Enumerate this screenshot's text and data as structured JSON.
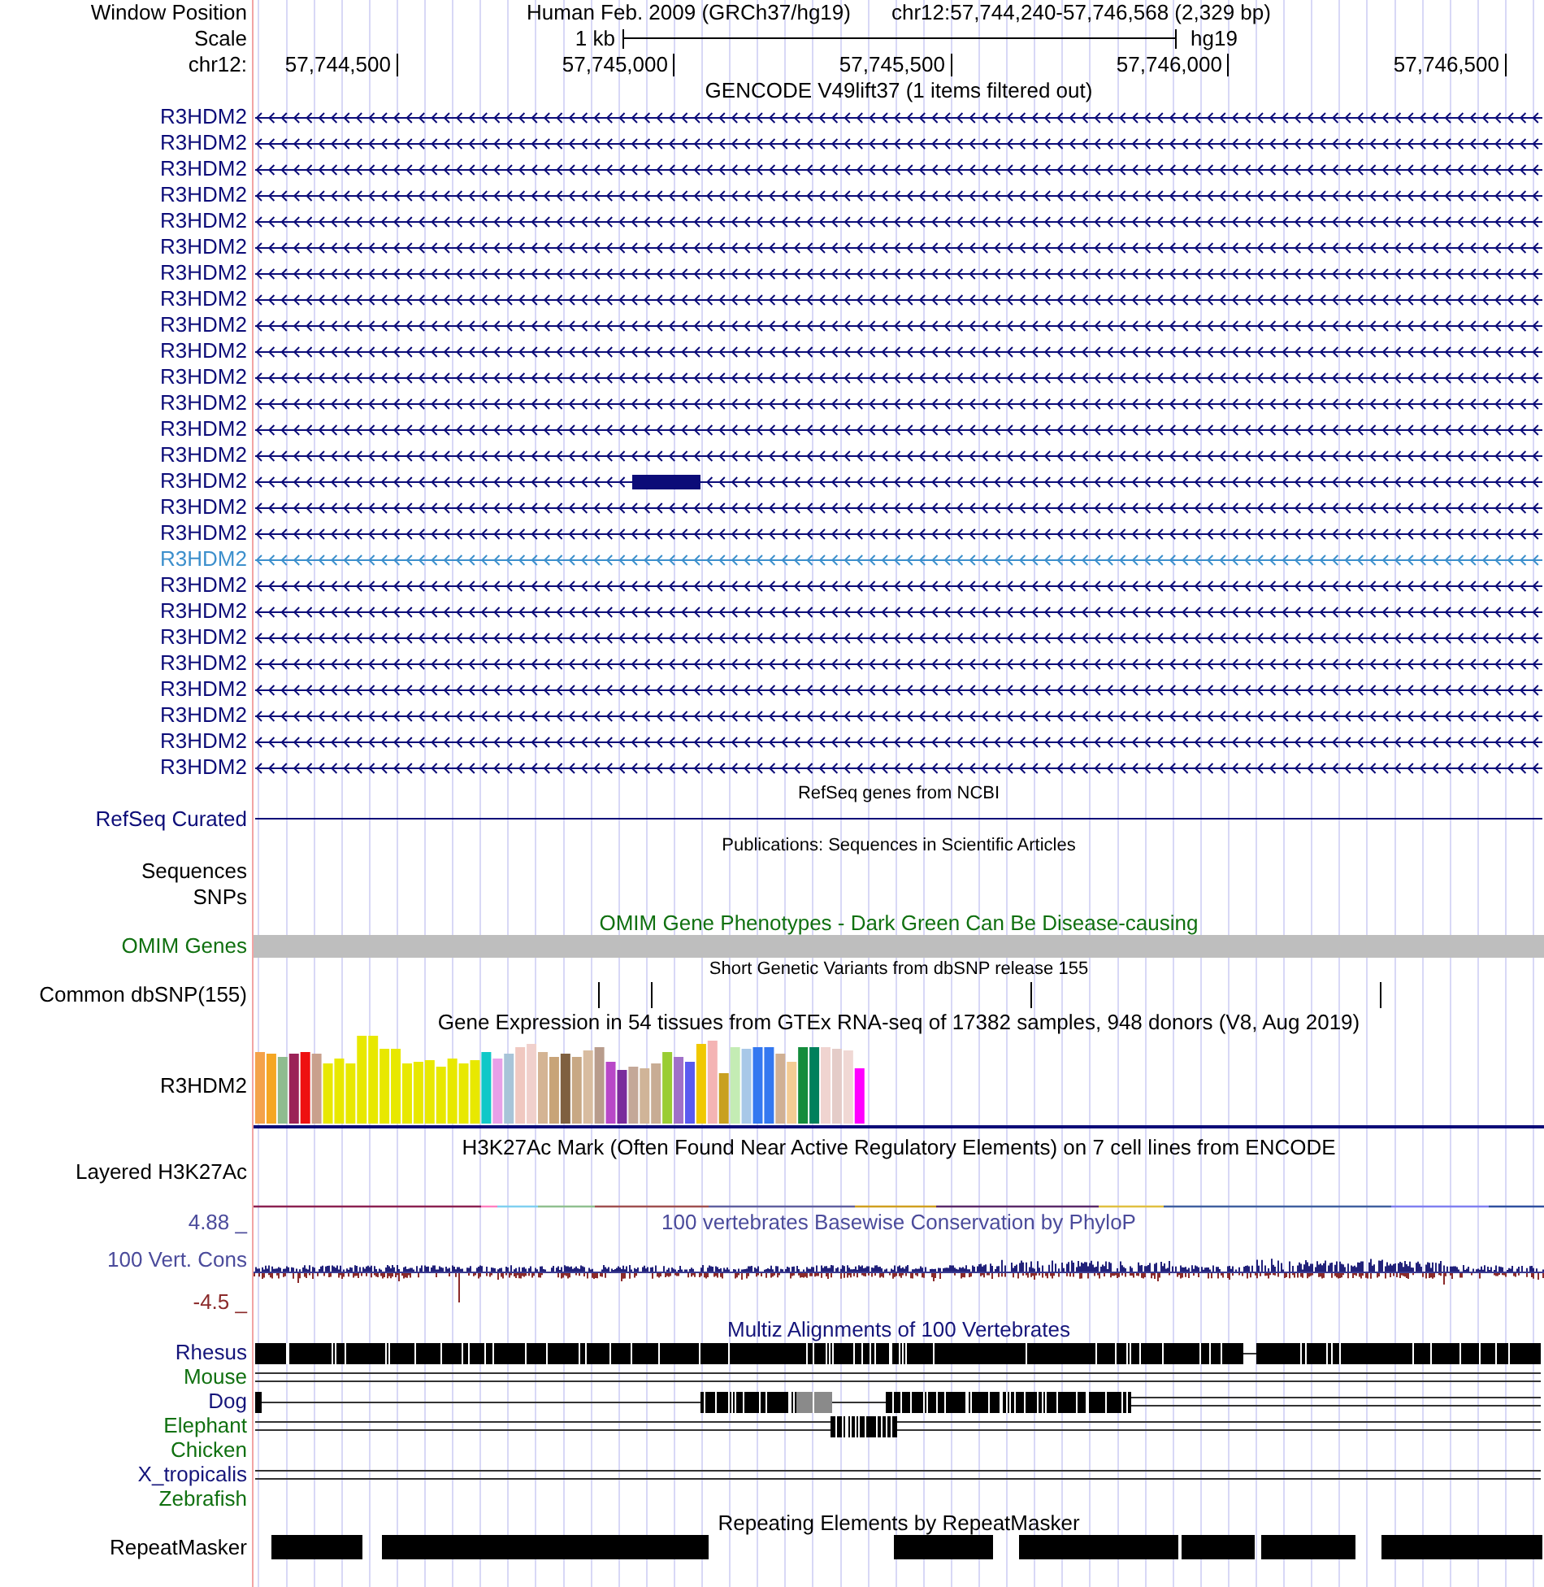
{
  "header": {
    "position_label": "Window Position",
    "assembly": "Human Feb. 2009 (GRCh37/hg19)",
    "position": "chr12:57,744,240-57,746,568 (2,329 bp)",
    "scale_label": "Scale",
    "scale": "1 kb",
    "database": "hg19",
    "ruler_label": "chr12:",
    "ruler_ticks": [
      "57,744,500",
      "57,745,000",
      "57,745,500",
      "57,746,000",
      "57,746,500"
    ]
  },
  "tracks": [
    {
      "kind": "genes",
      "title": "GENCODE V49lift37 (1 items filtered out)",
      "rows": [
        {
          "label": "R3HDM2",
          "color": "#0c0c78",
          "exon": false
        },
        {
          "label": "R3HDM2",
          "color": "#0c0c78",
          "exon": false
        },
        {
          "label": "R3HDM2",
          "color": "#0c0c78",
          "exon": false
        },
        {
          "label": "R3HDM2",
          "color": "#0c0c78",
          "exon": false
        },
        {
          "label": "R3HDM2",
          "color": "#0c0c78",
          "exon": false
        },
        {
          "label": "R3HDM2",
          "color": "#0c0c78",
          "exon": false
        },
        {
          "label": "R3HDM2",
          "color": "#0c0c78",
          "exon": false
        },
        {
          "label": "R3HDM2",
          "color": "#0c0c78",
          "exon": false
        },
        {
          "label": "R3HDM2",
          "color": "#0c0c78",
          "exon": false
        },
        {
          "label": "R3HDM2",
          "color": "#0c0c78",
          "exon": false
        },
        {
          "label": "R3HDM2",
          "color": "#0c0c78",
          "exon": false
        },
        {
          "label": "R3HDM2",
          "color": "#0c0c78",
          "exon": false
        },
        {
          "label": "R3HDM2",
          "color": "#0c0c78",
          "exon": false
        },
        {
          "label": "R3HDM2",
          "color": "#0c0c78",
          "exon": false
        },
        {
          "label": "R3HDM2",
          "color": "#0c0c78",
          "exon": true
        },
        {
          "label": "R3HDM2",
          "color": "#0c0c78",
          "exon": false
        },
        {
          "label": "R3HDM2",
          "color": "#0c0c78",
          "exon": false
        },
        {
          "label": "R3HDM2",
          "color": "#3c8fcc",
          "exon": false
        },
        {
          "label": "R3HDM2",
          "color": "#0c0c78",
          "exon": false
        },
        {
          "label": "R3HDM2",
          "color": "#0c0c78",
          "exon": false
        },
        {
          "label": "R3HDM2",
          "color": "#0c0c78",
          "exon": false
        },
        {
          "label": "R3HDM2",
          "color": "#0c0c78",
          "exon": false
        },
        {
          "label": "R3HDM2",
          "color": "#0c0c78",
          "exon": false
        },
        {
          "label": "R3HDM2",
          "color": "#0c0c78",
          "exon": false
        },
        {
          "label": "R3HDM2",
          "color": "#0c0c78",
          "exon": false
        },
        {
          "label": "R3HDM2",
          "color": "#0c0c78",
          "exon": false
        }
      ]
    },
    {
      "kind": "line",
      "title": "RefSeq genes from NCBI",
      "label": "RefSeq Curated"
    },
    {
      "kind": "subtracks",
      "title": "Publications: Sequences in Scientific Articles",
      "labels": [
        "Sequences",
        "SNPs"
      ]
    },
    {
      "kind": "bar",
      "title": "OMIM Gene Phenotypes - Dark Green Can Be Disease-causing",
      "label": "OMIM Genes"
    },
    {
      "kind": "variants",
      "title": "Short Genetic Variants from dbSNP release 155",
      "label": "Common dbSNP(155)"
    },
    {
      "kind": "expression",
      "title": "Gene Expression in 54 tissues from GTEx RNA-seq of 17382 samples, 948 donors (V8, Aug 2019)",
      "label": "R3HDM2"
    },
    {
      "kind": "layered",
      "title": "H3K27Ac Mark (Often Found Near Active Regulatory Elements) on 7 cell lines from ENCODE",
      "label": "Layered H3K27Ac"
    },
    {
      "kind": "wiggle",
      "title": "100 vertebrates Basewise Conservation by PhyloP",
      "label": "100 Vert. Cons",
      "max_label": "4.88 _",
      "min_label": "-4.5 _"
    },
    {
      "kind": "alignments",
      "title": "Multiz Alignments of 100 Vertebrates",
      "species": [
        {
          "label": "Rhesus",
          "color": "#14147a"
        },
        {
          "label": "Mouse",
          "color": "#107010"
        },
        {
          "label": "Dog",
          "color": "#14147a"
        },
        {
          "label": "Elephant",
          "color": "#107010"
        },
        {
          "label": "Chicken",
          "color": "#107010"
        },
        {
          "label": "X_tropicalis",
          "color": "#14147a"
        },
        {
          "label": "Zebrafish",
          "color": "#107010"
        }
      ]
    },
    {
      "kind": "repeats",
      "title": "Repeating Elements by RepeatMasker",
      "label": "RepeatMasker"
    }
  ]
}
